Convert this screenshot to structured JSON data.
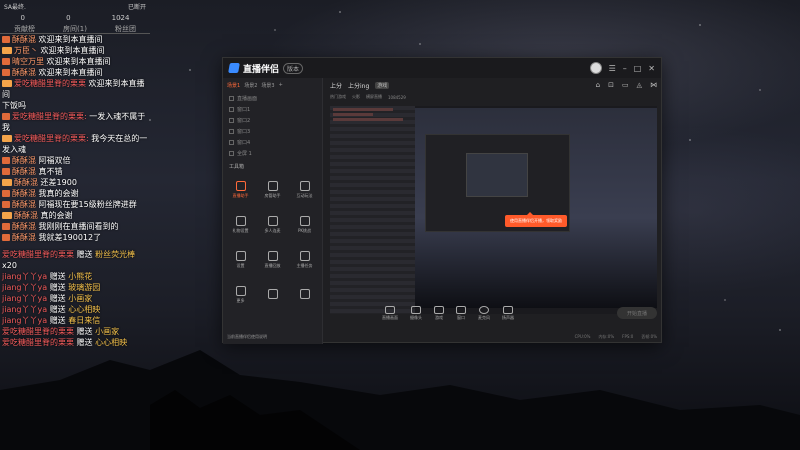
{
  "chat": {
    "top_left": "SA最终.",
    "top_right": "已断开",
    "stats": [
      "0",
      "0",
      "1024"
    ],
    "tabs": [
      "贡献榜",
      "房间(1)",
      "粉丝团"
    ],
    "messages": [
      {
        "user": "酥酥混",
        "text": "欢迎来到本直播间"
      },
      {
        "user": "万臣丶",
        "text": "欢迎来到本直播间"
      },
      {
        "user": "晴空万里",
        "text": "欢迎来到本直播间"
      },
      {
        "user": "酥酥混",
        "text": "欢迎来到本直播间"
      },
      {
        "user": "爱吃糖醋里脊的栗栗",
        "text": "欢迎来到本直播间"
      },
      {
        "user": "",
        "text": "下饭吗"
      },
      {
        "user": "爱吃糖醋里脊的栗栗:",
        "text": "一发入魂不属于我"
      },
      {
        "user": "爱吃糖醋里脊的栗栗:",
        "text": "我今天在总的一发入魂"
      },
      {
        "user": "酥酥混",
        "text": "阿福双倍"
      },
      {
        "user": "酥酥混",
        "text": "真不错"
      },
      {
        "user": "酥酥混",
        "text": "还差1900"
      },
      {
        "user": "酥酥混",
        "text": "我真的会谢"
      },
      {
        "user": "酥酥混",
        "text": "阿福现在要15级粉丝牌进群"
      },
      {
        "user": "酥酥混",
        "text": "真的会谢"
      },
      {
        "user": "酥酥混",
        "text": "我刚刚在直播间看到的"
      },
      {
        "user": "酥酥混",
        "text": "我就差190012了"
      }
    ],
    "gifts": [
      {
        "user": "爱吃糖醋里脊的栗栗",
        "verb": "赠送",
        "gift": "粉丝荧光棒",
        "count": "x20"
      },
      {
        "user": "jiang丫丫ya",
        "verb": "赠送",
        "gift": "小熊花",
        "count": ""
      },
      {
        "user": "jiang丫丫ya",
        "verb": "赠送",
        "gift": "玻璃游园",
        "count": ""
      },
      {
        "user": "jiang丫丫ya",
        "verb": "赠送",
        "gift": "小画家",
        "count": ""
      },
      {
        "user": "jiang丫丫ya",
        "verb": "赠送",
        "gift": "心心相映",
        "count": ""
      },
      {
        "user": "jiang丫丫ya",
        "verb": "赠送",
        "gift": "春日来信",
        "count": ""
      },
      {
        "user": "爱吃糖醋里脊的栗栗",
        "verb": "赠送",
        "gift": "小画家",
        "count": ""
      },
      {
        "user": "爱吃糖醋里脊的栗栗",
        "verb": "赠送",
        "gift": "心心相映",
        "count": ""
      }
    ]
  },
  "app": {
    "title": "直播伴侣",
    "version": "版本",
    "left_tabs": [
      "场景1",
      "场景2",
      "场景3",
      "+"
    ],
    "sources": [
      "直播画面",
      "窗口1",
      "窗口2",
      "窗口3",
      "窗口4",
      "全屏 1"
    ],
    "tools_label": "工具箱",
    "tools": [
      "直播助手",
      "房管助手",
      "互动玩法",
      "礼物设置",
      "多人连麦",
      "PK挑战",
      "设置",
      "直播回放",
      "主播任务",
      "更多",
      "",
      ""
    ],
    "footer": "当前直播伴侣使用说明",
    "header_title": "上分",
    "header_sub": "上分ing",
    "header_tag": "游戏",
    "sub_items": [
      "热门游戏",
      "火影",
      "横屏直播",
      "1084529"
    ],
    "tooltip": "使用直播伴侣开播，领取奖励",
    "controls": [
      "直播画面",
      "摄像头",
      "游戏",
      "窗口",
      "麦克风",
      "扬声器"
    ],
    "start_button": "开始直播",
    "status": [
      "CPU:0%",
      "内存:0%",
      "FPS:0",
      "丢帧:0%"
    ]
  },
  "colors": {
    "accent": "#ff6a3a",
    "bg": "#1f1f22"
  }
}
